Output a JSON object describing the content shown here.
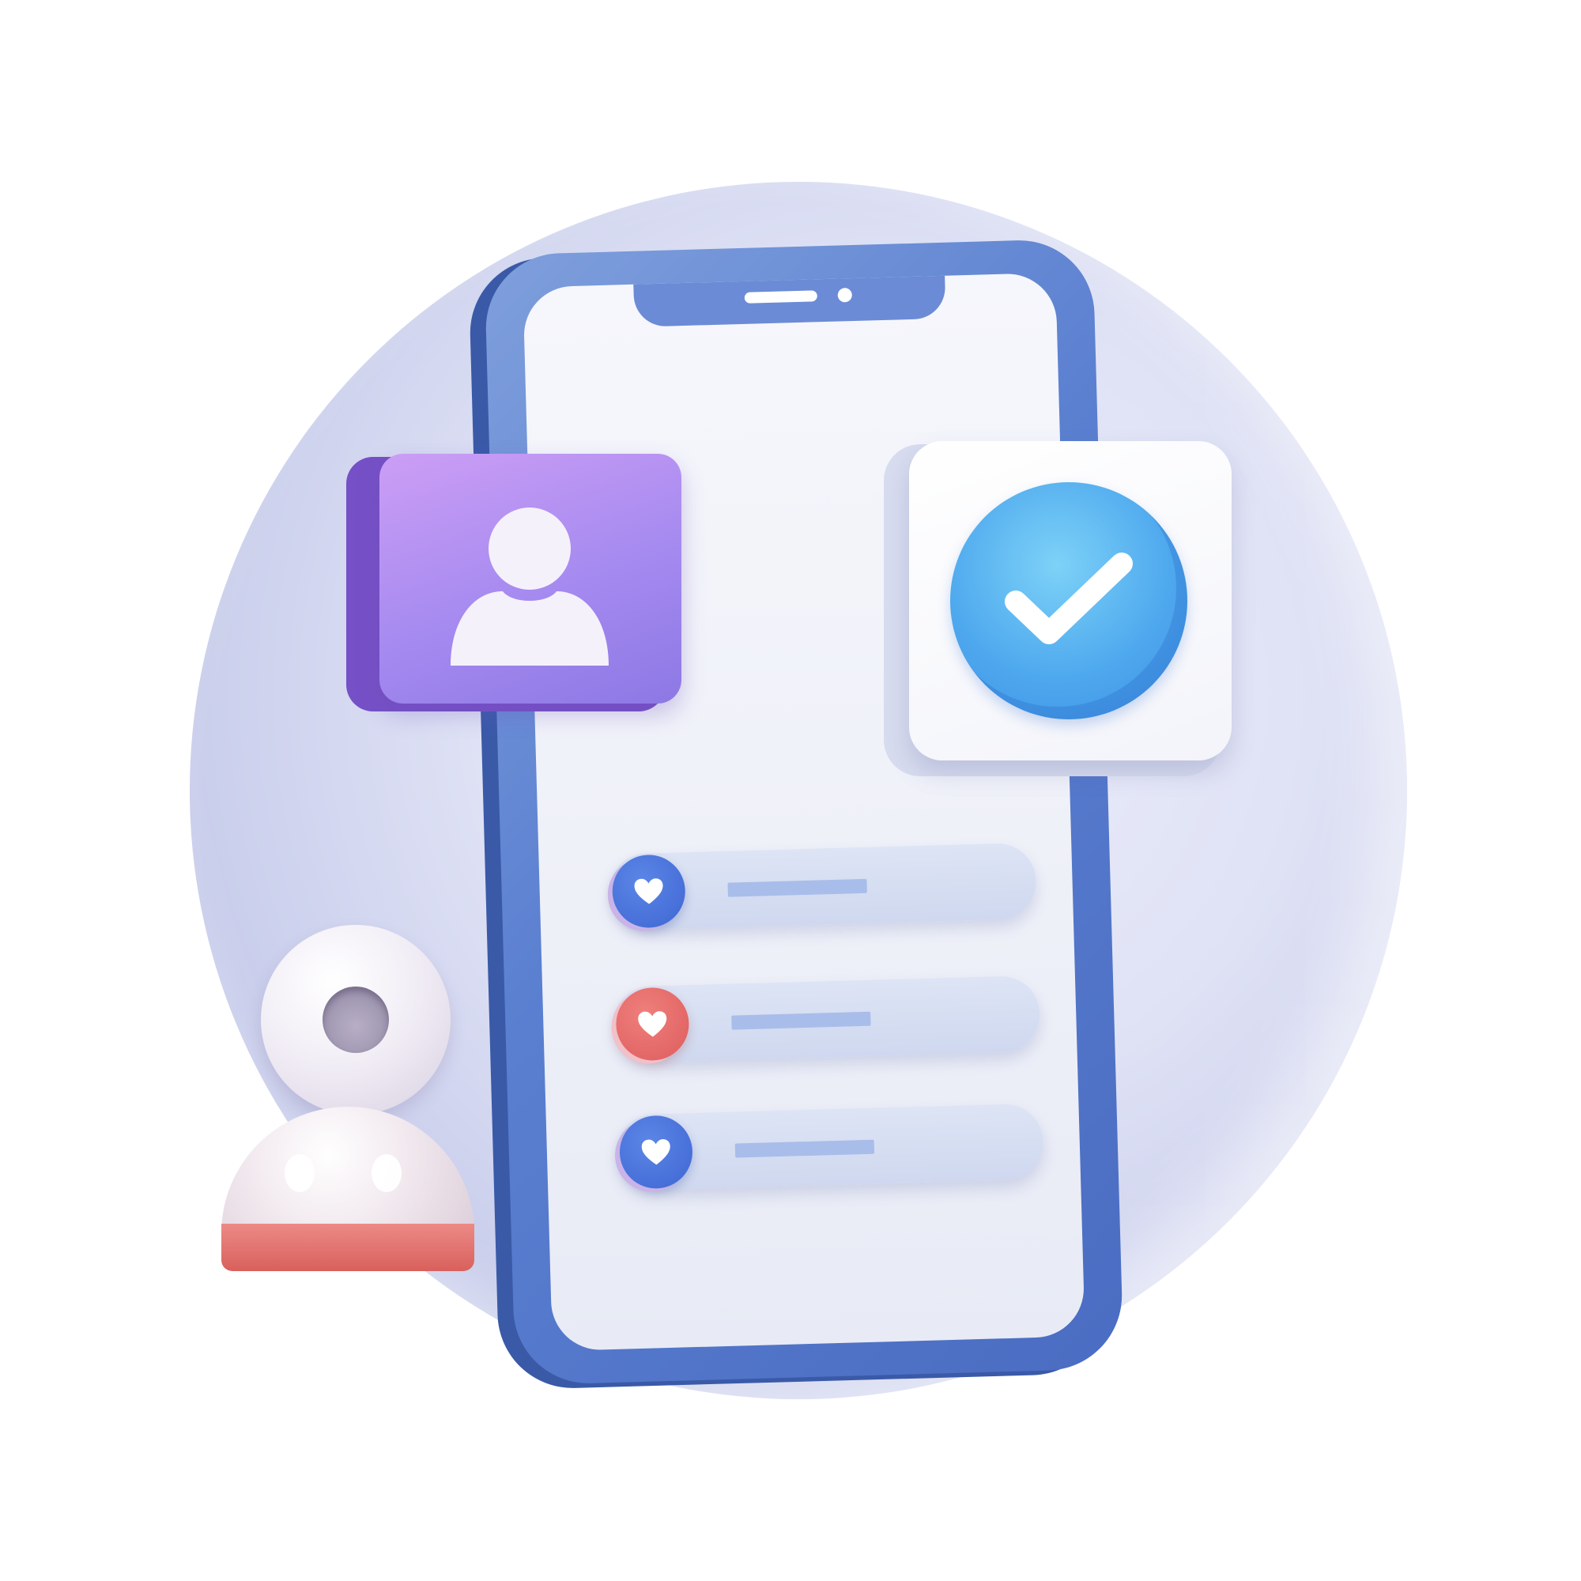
{
  "scene": {
    "background_color": "#ffffff",
    "circle_color": "#dfe2f5",
    "phone_frame_color": "#5a7fd0",
    "profile_card_color": "#a58af0",
    "check_card_color": "#ffffff",
    "check_circle_color": "#4fa9ee"
  },
  "icons": {
    "profile": "user-icon",
    "verified": "check-icon",
    "favorite": "heart-icon",
    "figure": "person-figure"
  },
  "list_rows": [
    {
      "icon": "heart-icon",
      "badge_color": "#3f66d3"
    },
    {
      "icon": "heart-icon",
      "badge_color": "#dd5d5d"
    },
    {
      "icon": "heart-icon",
      "badge_color": "#3f66d3"
    }
  ]
}
